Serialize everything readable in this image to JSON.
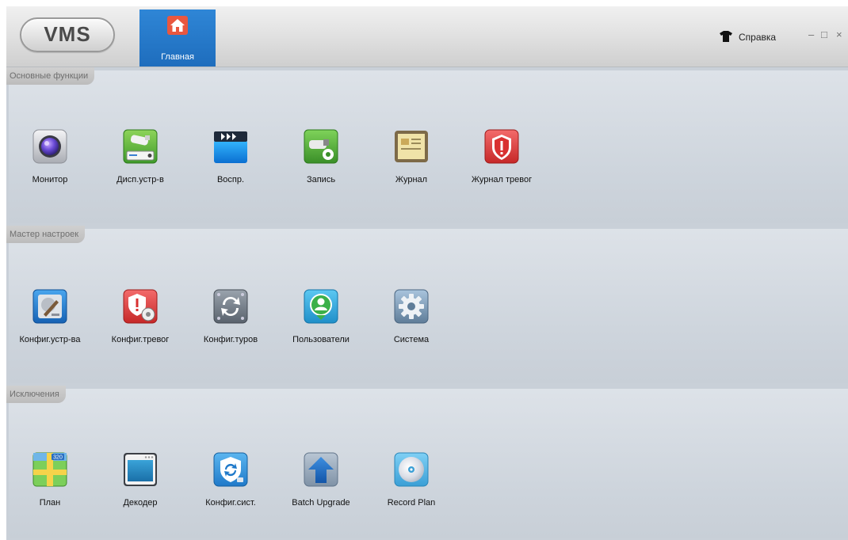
{
  "app": {
    "logo_text": "VMS"
  },
  "header": {
    "home_tab_label": "Главная",
    "help_label": "Справка",
    "minimize_glyph": "–",
    "maximize_glyph": "□",
    "close_glyph": "×"
  },
  "sections": [
    {
      "title": "Основные функции",
      "items": [
        {
          "label": "Монитор",
          "icon": "monitor-icon"
        },
        {
          "label": "Дисп.устр-в",
          "icon": "device-manager-icon"
        },
        {
          "label": "Воспр.",
          "icon": "playback-icon"
        },
        {
          "label": "Запись",
          "icon": "record-icon"
        },
        {
          "label": "Журнал",
          "icon": "log-icon"
        },
        {
          "label": "Журнал тревог",
          "icon": "alarm-log-icon"
        }
      ]
    },
    {
      "title": "Мастер настроек",
      "items": [
        {
          "label": "Конфиг.устр-ва",
          "icon": "device-config-icon"
        },
        {
          "label": "Конфиг.тревог",
          "icon": "alarm-config-icon"
        },
        {
          "label": "Конфиг.туров",
          "icon": "tour-config-icon"
        },
        {
          "label": "Пользователи",
          "icon": "users-icon"
        },
        {
          "label": "Система",
          "icon": "system-gear-icon"
        }
      ]
    },
    {
      "title": "Исключения",
      "items": [
        {
          "label": "План",
          "icon": "emap-plan-icon"
        },
        {
          "label": "Декодер",
          "icon": "decoder-icon"
        },
        {
          "label": "Конфиг.сист.",
          "icon": "system-config-icon"
        },
        {
          "label": "Batch Upgrade",
          "icon": "batch-upgrade-icon"
        },
        {
          "label": "Record Plan",
          "icon": "record-plan-icon"
        }
      ]
    }
  ]
}
